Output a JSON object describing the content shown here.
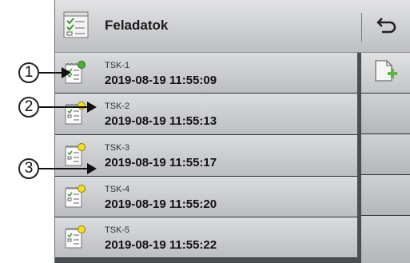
{
  "header": {
    "title": "Feladatok",
    "icon": "task-list-icon",
    "back_icon": "back-arrow-icon"
  },
  "tasks": [
    {
      "name": "TSK-1",
      "time": "2019-08-19 11:55:09",
      "status_color": "#4caf32"
    },
    {
      "name": "TSK-2",
      "time": "2019-08-19 11:55:13",
      "status_color": "#f0e020"
    },
    {
      "name": "TSK-3",
      "time": "2019-08-19 11:55:17",
      "status_color": "#f0e020"
    },
    {
      "name": "TSK-4",
      "time": "2019-08-19 11:55:20",
      "status_color": "#f0e020"
    },
    {
      "name": "TSK-5",
      "time": "2019-08-19 11:55:22",
      "status_color": "#f0e020"
    }
  ],
  "sidebar": {
    "add_icon": "add-task-icon"
  },
  "callouts": [
    "1",
    "2",
    "3"
  ]
}
